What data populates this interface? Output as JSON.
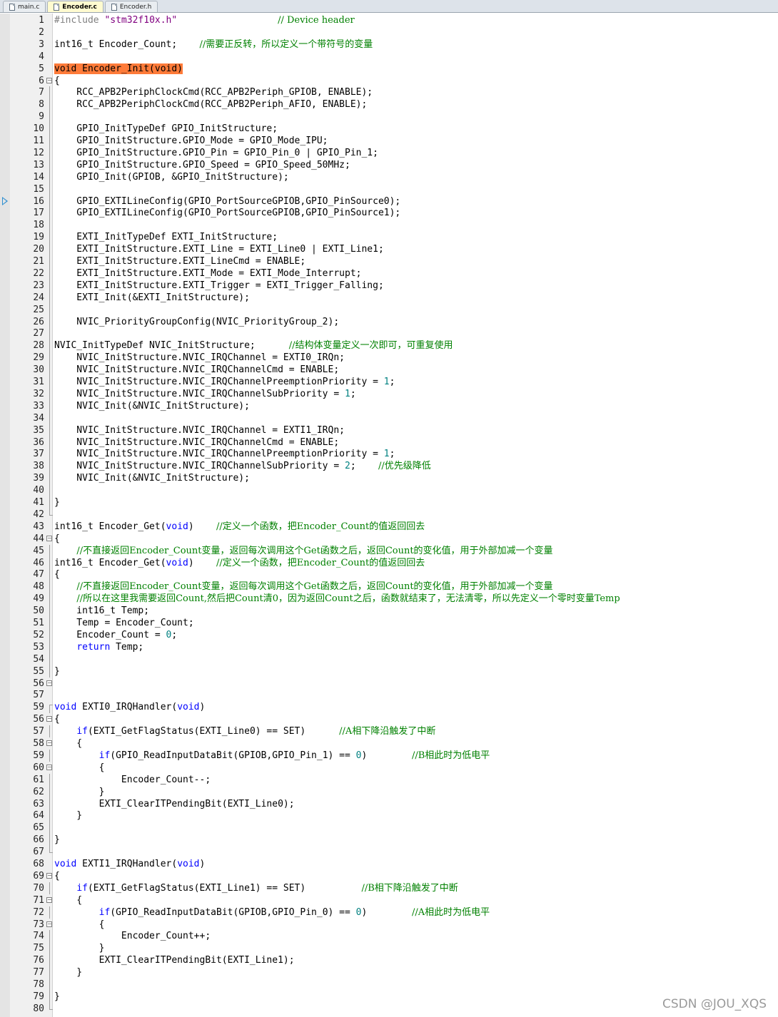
{
  "window": {
    "tabs": [
      {
        "label": "main.c",
        "active": false
      },
      {
        "label": "Encoder.c",
        "active": true
      },
      {
        "label": "Encoder.h",
        "active": false
      }
    ]
  },
  "editor": {
    "active_file": "Encoder.c",
    "exec_arrow_line": 16,
    "highlight_color": "#ff7b39",
    "lines": [
      {
        "n": "1",
        "fold": "",
        "code": [
          {
            "t": "pp",
            "s": "#include "
          },
          {
            "t": "str",
            "s": "\"stm32f10x.h\""
          },
          {
            "t": "",
            "s": "                  "
          },
          {
            "t": "cm",
            "s": "// Device header"
          }
        ]
      },
      {
        "n": "2",
        "fold": "",
        "code": []
      },
      {
        "n": "3",
        "fold": "",
        "code": [
          {
            "t": "",
            "s": "int16_t Encoder_Count;    "
          },
          {
            "t": "cm",
            "s": "//需要正反转，所以定义一个带符号的变量"
          }
        ]
      },
      {
        "n": "4",
        "fold": "",
        "code": []
      },
      {
        "n": "5",
        "fold": "",
        "code": [
          {
            "t": "hl",
            "s": "void Encoder_Init(void)"
          }
        ]
      },
      {
        "n": "6",
        "fold": "open",
        "code": [
          {
            "t": "",
            "s": "{"
          }
        ]
      },
      {
        "n": "7",
        "fold": "line",
        "code": [
          {
            "t": "",
            "s": "    RCC_APB2PeriphClockCmd(RCC_APB2Periph_GPIOB, ENABLE);"
          }
        ]
      },
      {
        "n": "8",
        "fold": "line",
        "code": [
          {
            "t": "",
            "s": "    RCC_APB2PeriphClockCmd(RCC_APB2Periph_AFIO, ENABLE);"
          }
        ]
      },
      {
        "n": "9",
        "fold": "line",
        "code": []
      },
      {
        "n": "10",
        "fold": "line",
        "code": [
          {
            "t": "",
            "s": "    GPIO_InitTypeDef GPIO_InitStructure;"
          }
        ]
      },
      {
        "n": "11",
        "fold": "line",
        "code": [
          {
            "t": "",
            "s": "    GPIO_InitStructure.GPIO_Mode = GPIO_Mode_IPU;"
          }
        ]
      },
      {
        "n": "12",
        "fold": "line",
        "code": [
          {
            "t": "",
            "s": "    GPIO_InitStructure.GPIO_Pin = GPIO_Pin_0 | GPIO_Pin_1;"
          }
        ]
      },
      {
        "n": "13",
        "fold": "line",
        "code": [
          {
            "t": "",
            "s": "    GPIO_InitStructure.GPIO_Speed = GPIO_Speed_50MHz;"
          }
        ]
      },
      {
        "n": "14",
        "fold": "line",
        "code": [
          {
            "t": "",
            "s": "    GPIO_Init(GPIOB, &GPIO_InitStructure);"
          }
        ]
      },
      {
        "n": "15",
        "fold": "line",
        "code": []
      },
      {
        "n": "16",
        "fold": "line",
        "code": [
          {
            "t": "",
            "s": "    GPIO_EXTILineConfig(GPIO_PortSourceGPIOB,GPIO_PinSource0);"
          }
        ]
      },
      {
        "n": "17",
        "fold": "line",
        "code": [
          {
            "t": "",
            "s": "    GPIO_EXTILineConfig(GPIO_PortSourceGPIOB,GPIO_PinSource1);"
          }
        ]
      },
      {
        "n": "18",
        "fold": "line",
        "code": []
      },
      {
        "n": "19",
        "fold": "line",
        "code": [
          {
            "t": "",
            "s": "    EXTI_InitTypeDef EXTI_InitStructure;"
          }
        ]
      },
      {
        "n": "20",
        "fold": "line",
        "code": [
          {
            "t": "",
            "s": "    EXTI_InitStructure.EXTI_Line = EXTI_Line0 | EXTI_Line1;"
          }
        ]
      },
      {
        "n": "21",
        "fold": "line",
        "code": [
          {
            "t": "",
            "s": "    EXTI_InitStructure.EXTI_LineCmd = ENABLE;"
          }
        ]
      },
      {
        "n": "22",
        "fold": "line",
        "code": [
          {
            "t": "",
            "s": "    EXTI_InitStructure.EXTI_Mode = EXTI_Mode_Interrupt;"
          }
        ]
      },
      {
        "n": "23",
        "fold": "line",
        "code": [
          {
            "t": "",
            "s": "    EXTI_InitStructure.EXTI_Trigger = EXTI_Trigger_Falling;"
          }
        ]
      },
      {
        "n": "24",
        "fold": "line",
        "code": [
          {
            "t": "",
            "s": "    EXTI_Init(&EXTI_InitStructure);"
          }
        ]
      },
      {
        "n": "25",
        "fold": "line",
        "code": []
      },
      {
        "n": "26",
        "fold": "line",
        "code": [
          {
            "t": "",
            "s": "    NVIC_PriorityGroupConfig(NVIC_PriorityGroup_2);"
          }
        ]
      },
      {
        "n": "27",
        "fold": "line",
        "code": []
      },
      {
        "n": "28",
        "fold": "line",
        "code": [
          {
            "t": "",
            "s": "NVIC_InitTypeDef NVIC_InitStructure;      "
          },
          {
            "t": "cm",
            "s": "//结构体变量定义一次即可，可重复使用"
          }
        ]
      },
      {
        "n": "29",
        "fold": "line",
        "code": [
          {
            "t": "",
            "s": "    NVIC_InitStructure.NVIC_IRQChannel = EXTI0_IRQn;"
          }
        ]
      },
      {
        "n": "30",
        "fold": "line",
        "code": [
          {
            "t": "",
            "s": "    NVIC_InitStructure.NVIC_IRQChannelCmd = ENABLE;"
          }
        ]
      },
      {
        "n": "31",
        "fold": "line",
        "code": [
          {
            "t": "",
            "s": "    NVIC_InitStructure.NVIC_IRQChannelPreemptionPriority = "
          },
          {
            "t": "num",
            "s": "1"
          },
          {
            "t": "",
            "s": ";"
          }
        ]
      },
      {
        "n": "32",
        "fold": "line",
        "code": [
          {
            "t": "",
            "s": "    NVIC_InitStructure.NVIC_IRQChannelSubPriority = "
          },
          {
            "t": "num",
            "s": "1"
          },
          {
            "t": "",
            "s": ";"
          }
        ]
      },
      {
        "n": "33",
        "fold": "line",
        "code": [
          {
            "t": "",
            "s": "    NVIC_Init(&NVIC_InitStructure);"
          }
        ]
      },
      {
        "n": "34",
        "fold": "line",
        "code": []
      },
      {
        "n": "35",
        "fold": "line",
        "code": [
          {
            "t": "",
            "s": "    NVIC_InitStructure.NVIC_IRQChannel = EXTI1_IRQn;"
          }
        ]
      },
      {
        "n": "36",
        "fold": "line",
        "code": [
          {
            "t": "",
            "s": "    NVIC_InitStructure.NVIC_IRQChannelCmd = ENABLE;"
          }
        ]
      },
      {
        "n": "37",
        "fold": "line",
        "code": [
          {
            "t": "",
            "s": "    NVIC_InitStructure.NVIC_IRQChannelPreemptionPriority = "
          },
          {
            "t": "num",
            "s": "1"
          },
          {
            "t": "",
            "s": ";"
          }
        ]
      },
      {
        "n": "38",
        "fold": "line",
        "code": [
          {
            "t": "",
            "s": "    NVIC_InitStructure.NVIC_IRQChannelSubPriority = "
          },
          {
            "t": "num",
            "s": "2"
          },
          {
            "t": "",
            "s": ";    "
          },
          {
            "t": "cm",
            "s": "//优先级降低"
          }
        ]
      },
      {
        "n": "39",
        "fold": "line",
        "code": [
          {
            "t": "",
            "s": "    NVIC_Init(&NVIC_InitStructure);"
          }
        ]
      },
      {
        "n": "40",
        "fold": "line",
        "code": []
      },
      {
        "n": "41",
        "fold": "line",
        "code": [
          {
            "t": "",
            "s": "}"
          }
        ]
      },
      {
        "n": "42",
        "fold": "end",
        "code": []
      },
      {
        "n": "43",
        "fold": "",
        "code": [
          {
            "t": "",
            "s": "int16_t Encoder_Get("
          },
          {
            "t": "kw",
            "s": "void"
          },
          {
            "t": "",
            "s": ")    "
          },
          {
            "t": "cm",
            "s": "//定义一个函数，把Encoder_Count的值返回回去"
          }
        ]
      },
      {
        "n": "44",
        "fold": "open",
        "code": [
          {
            "t": "",
            "s": "{"
          }
        ]
      },
      {
        "n": "45",
        "fold": "line",
        "code": [
          {
            "t": "",
            "s": "    "
          },
          {
            "t": "cm",
            "s": "//不直接返回Encoder_Count变量，返回每次调用这个Get函数之后，返回Count的变化值，用于外部加减一个变量"
          }
        ]
      },
      {
        "n": "46",
        "fold": "line",
        "code": [
          {
            "t": "",
            "s": "int16_t Encoder_Get("
          },
          {
            "t": "kw",
            "s": "void"
          },
          {
            "t": "",
            "s": ")    "
          },
          {
            "t": "cm",
            "s": "//定义一个函数，把Encoder_Count的值返回回去"
          }
        ]
      },
      {
        "n": "47",
        "fold": "line",
        "code": [
          {
            "t": "",
            "s": "{"
          }
        ]
      },
      {
        "n": "48",
        "fold": "line",
        "code": [
          {
            "t": "",
            "s": "    "
          },
          {
            "t": "cm",
            "s": "//不直接返回Encoder_Count变量，返回每次调用这个Get函数之后，返回Count的变化值，用于外部加减一个变量"
          }
        ]
      },
      {
        "n": "49",
        "fold": "line",
        "code": [
          {
            "t": "",
            "s": "    "
          },
          {
            "t": "cm",
            "s": "//所以在这里我需要返回Count,然后把Count清0，因为返回Count之后，函数就结束了，无法清零，所以先定义一个零时变量Temp"
          }
        ]
      },
      {
        "n": "50",
        "fold": "line",
        "code": [
          {
            "t": "",
            "s": "    int16_t Temp;"
          }
        ]
      },
      {
        "n": "51",
        "fold": "line",
        "code": [
          {
            "t": "",
            "s": "    Temp = Encoder_Count;"
          }
        ]
      },
      {
        "n": "52",
        "fold": "line",
        "code": [
          {
            "t": "",
            "s": "    Encoder_Count = "
          },
          {
            "t": "num",
            "s": "0"
          },
          {
            "t": "",
            "s": ";"
          }
        ]
      },
      {
        "n": "53",
        "fold": "line",
        "code": [
          {
            "t": "",
            "s": "    "
          },
          {
            "t": "kw",
            "s": "return"
          },
          {
            "t": "",
            "s": " Temp;"
          }
        ]
      },
      {
        "n": "54",
        "fold": "line",
        "code": []
      },
      {
        "n": "55",
        "fold": "line",
        "code": [
          {
            "t": "",
            "s": "}"
          }
        ]
      },
      {
        "n": "56",
        "fold": "box",
        "code": []
      },
      {
        "n": "57",
        "fold": "",
        "code": []
      },
      {
        "n": "59",
        "fold": "start",
        "code": [
          {
            "t": "kw",
            "s": "void"
          },
          {
            "t": "",
            "s": " EXTI0_IRQHandler("
          },
          {
            "t": "kw",
            "s": "void"
          },
          {
            "t": "",
            "s": ")"
          }
        ]
      },
      {
        "n": "56",
        "fold": "open",
        "code": [
          {
            "t": "",
            "s": "{"
          }
        ]
      },
      {
        "n": "57",
        "fold": "line",
        "code": [
          {
            "t": "",
            "s": "    "
          },
          {
            "t": "kw",
            "s": "if"
          },
          {
            "t": "",
            "s": "(EXTI_GetFlagStatus(EXTI_Line0) == SET)      "
          },
          {
            "t": "cm",
            "s": "//A相下降沿触发了中断"
          }
        ]
      },
      {
        "n": "58",
        "fold": "open",
        "code": [
          {
            "t": "",
            "s": "    {"
          }
        ]
      },
      {
        "n": "59",
        "fold": "line",
        "code": [
          {
            "t": "",
            "s": "        "
          },
          {
            "t": "kw",
            "s": "if"
          },
          {
            "t": "",
            "s": "(GPIO_ReadInputDataBit(GPIOB,GPIO_Pin_1) == "
          },
          {
            "t": "num",
            "s": "0"
          },
          {
            "t": "",
            "s": ")        "
          },
          {
            "t": "cm",
            "s": "//B相此时为低电平"
          }
        ]
      },
      {
        "n": "60",
        "fold": "open",
        "code": [
          {
            "t": "",
            "s": "        {"
          }
        ]
      },
      {
        "n": "61",
        "fold": "line",
        "code": [
          {
            "t": "",
            "s": "            Encoder_Count--;"
          }
        ]
      },
      {
        "n": "62",
        "fold": "line",
        "code": [
          {
            "t": "",
            "s": "        }"
          }
        ]
      },
      {
        "n": "63",
        "fold": "line",
        "code": [
          {
            "t": "",
            "s": "        EXTI_ClearITPendingBit(EXTI_Line0);"
          }
        ]
      },
      {
        "n": "64",
        "fold": "line",
        "code": [
          {
            "t": "",
            "s": "    }"
          }
        ]
      },
      {
        "n": "65",
        "fold": "line",
        "code": []
      },
      {
        "n": "66",
        "fold": "line",
        "code": [
          {
            "t": "",
            "s": "}"
          }
        ]
      },
      {
        "n": "67",
        "fold": "end",
        "code": []
      },
      {
        "n": "68",
        "fold": "",
        "code": [
          {
            "t": "kw",
            "s": "void"
          },
          {
            "t": "",
            "s": " EXTI1_IRQHandler("
          },
          {
            "t": "kw",
            "s": "void"
          },
          {
            "t": "",
            "s": ")"
          }
        ]
      },
      {
        "n": "69",
        "fold": "open",
        "code": [
          {
            "t": "",
            "s": "{"
          }
        ]
      },
      {
        "n": "70",
        "fold": "line",
        "code": [
          {
            "t": "",
            "s": "    "
          },
          {
            "t": "kw",
            "s": "if"
          },
          {
            "t": "",
            "s": "(EXTI_GetFlagStatus(EXTI_Line1) == SET)          "
          },
          {
            "t": "cm",
            "s": "//B相下降沿触发了中断"
          }
        ]
      },
      {
        "n": "71",
        "fold": "open",
        "code": [
          {
            "t": "",
            "s": "    {"
          }
        ]
      },
      {
        "n": "72",
        "fold": "line",
        "code": [
          {
            "t": "",
            "s": "        "
          },
          {
            "t": "kw",
            "s": "if"
          },
          {
            "t": "",
            "s": "(GPIO_ReadInputDataBit(GPIOB,GPIO_Pin_0) == "
          },
          {
            "t": "num",
            "s": "0"
          },
          {
            "t": "",
            "s": ")        "
          },
          {
            "t": "cm",
            "s": "//A相此时为低电平"
          }
        ]
      },
      {
        "n": "73",
        "fold": "open",
        "code": [
          {
            "t": "",
            "s": "        {"
          }
        ]
      },
      {
        "n": "74",
        "fold": "line",
        "code": [
          {
            "t": "",
            "s": "            Encoder_Count++;"
          }
        ]
      },
      {
        "n": "75",
        "fold": "line",
        "code": [
          {
            "t": "",
            "s": "        }"
          }
        ]
      },
      {
        "n": "76",
        "fold": "line",
        "code": [
          {
            "t": "",
            "s": "        EXTI_ClearITPendingBit(EXTI_Line1);"
          }
        ]
      },
      {
        "n": "77",
        "fold": "line",
        "code": [
          {
            "t": "",
            "s": "    }"
          }
        ]
      },
      {
        "n": "78",
        "fold": "line",
        "code": []
      },
      {
        "n": "79",
        "fold": "line",
        "code": [
          {
            "t": "",
            "s": "}"
          }
        ]
      },
      {
        "n": "80",
        "fold": "end",
        "code": []
      }
    ]
  },
  "watermark": "CSDN @JOU_XQS"
}
